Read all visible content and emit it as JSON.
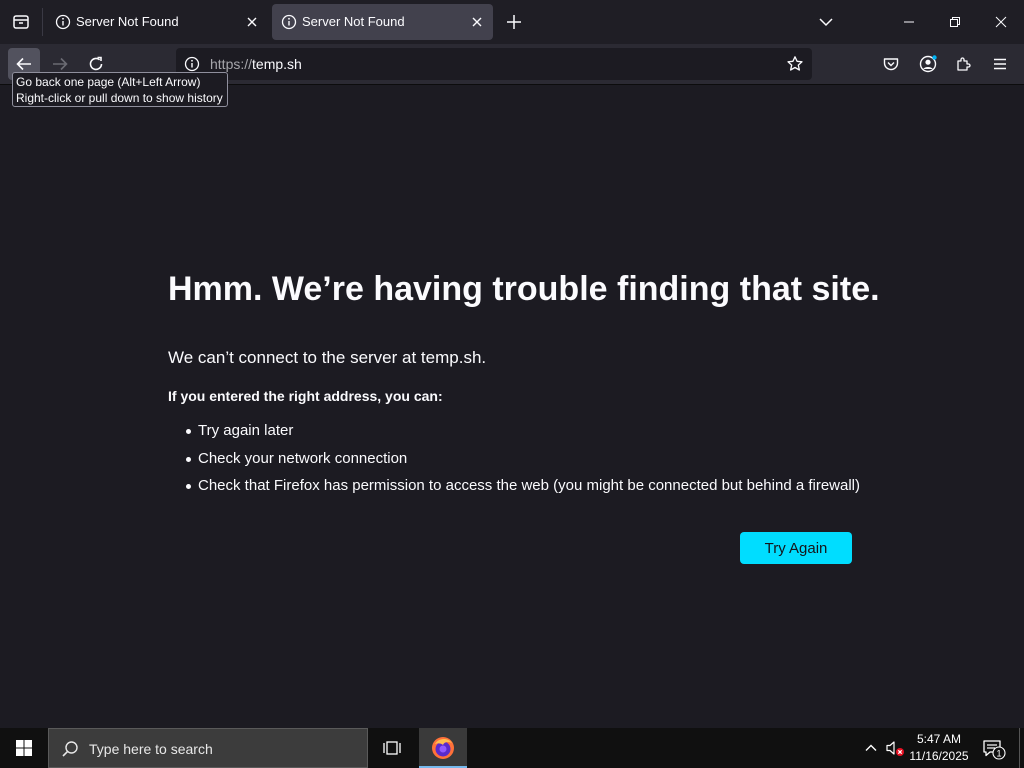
{
  "tabs": [
    {
      "title": "Server Not Found",
      "active": false
    },
    {
      "title": "Server Not Found",
      "active": true
    }
  ],
  "tooltip": {
    "line1": "Go back one page (Alt+Left Arrow)",
    "line2": "Right-click or pull down to show history"
  },
  "urlbar": {
    "scheme": "https://",
    "host": "temp.sh"
  },
  "error": {
    "title": "Hmm. We’re having trouble finding that site.",
    "description": "We can’t connect to the server at temp.sh.",
    "subheading": "If you entered the right address, you can:",
    "suggestions": [
      "Try again later",
      "Check your network connection",
      "Check that Firefox has permission to access the web (you might be connected but behind a firewall)"
    ],
    "button_label": "Try Again"
  },
  "taskbar": {
    "search_placeholder": "Type here to search",
    "time": "5:47 AM",
    "date": "11/16/2025",
    "notification_count": "1"
  },
  "colors": {
    "page_bg": "#1c1b22",
    "toolbar_bg": "#2b2a33",
    "accent": "#00ddff",
    "taskbar_bg": "#101010"
  }
}
